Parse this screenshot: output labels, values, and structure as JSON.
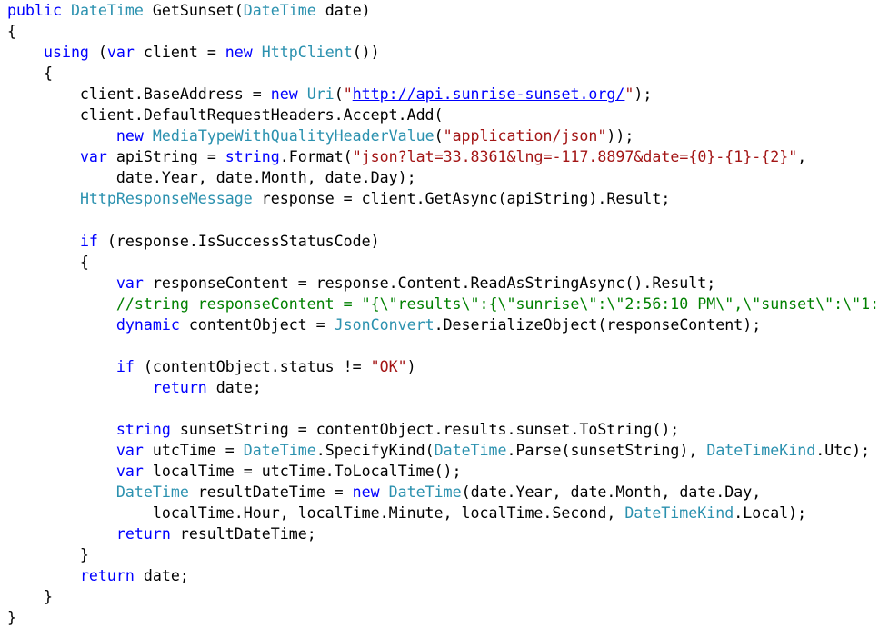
{
  "editor": {
    "language": "C#",
    "colors": {
      "keyword": "#0000ff",
      "type": "#2b91af",
      "string": "#a31515",
      "comment": "#008000",
      "text": "#000000",
      "background": "#ffffff"
    },
    "lines": [
      [
        [
          "kw",
          "public"
        ],
        [
          "t",
          " "
        ],
        [
          "ty",
          "DateTime"
        ],
        [
          "t",
          " GetSunset("
        ],
        [
          "ty",
          "DateTime"
        ],
        [
          "t",
          " date)"
        ]
      ],
      [
        [
          "t",
          "{"
        ]
      ],
      [
        [
          "t",
          "    "
        ],
        [
          "kw",
          "using"
        ],
        [
          "t",
          " ("
        ],
        [
          "kw",
          "var"
        ],
        [
          "t",
          " client = "
        ],
        [
          "kw",
          "new"
        ],
        [
          "t",
          " "
        ],
        [
          "ty",
          "HttpClient"
        ],
        [
          "t",
          "())"
        ]
      ],
      [
        [
          "t",
          "    {"
        ]
      ],
      [
        [
          "t",
          "        client.BaseAddress = "
        ],
        [
          "kw",
          "new"
        ],
        [
          "t",
          " "
        ],
        [
          "ty",
          "Uri"
        ],
        [
          "t",
          "("
        ],
        [
          "st",
          "\""
        ],
        [
          "url",
          "http://api.sunrise-sunset.org/"
        ],
        [
          "st",
          "\""
        ],
        [
          "t",
          ");"
        ]
      ],
      [
        [
          "t",
          "        client.DefaultRequestHeaders.Accept.Add("
        ]
      ],
      [
        [
          "t",
          "            "
        ],
        [
          "kw",
          "new"
        ],
        [
          "t",
          " "
        ],
        [
          "ty",
          "MediaTypeWithQualityHeaderValue"
        ],
        [
          "t",
          "("
        ],
        [
          "st",
          "\"application/json\""
        ],
        [
          "t",
          "));"
        ]
      ],
      [
        [
          "t",
          "        "
        ],
        [
          "kw",
          "var"
        ],
        [
          "t",
          " apiString = "
        ],
        [
          "kw",
          "string"
        ],
        [
          "t",
          ".Format("
        ],
        [
          "st",
          "\"json?lat=33.8361&lng=-117.8897&date={0}-{1}-{2}\""
        ],
        [
          "t",
          ","
        ]
      ],
      [
        [
          "t",
          "            date.Year, date.Month, date.Day);"
        ]
      ],
      [
        [
          "t",
          "        "
        ],
        [
          "ty",
          "HttpResponseMessage"
        ],
        [
          "t",
          " response = client.GetAsync(apiString).Result;"
        ]
      ],
      [
        [
          "t",
          ""
        ]
      ],
      [
        [
          "t",
          "        "
        ],
        [
          "kw",
          "if"
        ],
        [
          "t",
          " (response.IsSuccessStatusCode)"
        ]
      ],
      [
        [
          "t",
          "        {"
        ]
      ],
      [
        [
          "t",
          "            "
        ],
        [
          "kw",
          "var"
        ],
        [
          "t",
          " responseContent = response.Content.ReadAsStringAsync().Result;"
        ]
      ],
      [
        [
          "t",
          "            "
        ],
        [
          "cm",
          "//string responseContent = \"{\\\"results\\\":{\\\"sunrise\\\":\\\"2:56:10 PM\\\",\\\"sunset\\\":\\\"1:"
        ]
      ],
      [
        [
          "t",
          "            "
        ],
        [
          "kw",
          "dynamic"
        ],
        [
          "t",
          " contentObject = "
        ],
        [
          "ty",
          "JsonConvert"
        ],
        [
          "t",
          ".DeserializeObject(responseContent);"
        ]
      ],
      [
        [
          "t",
          ""
        ]
      ],
      [
        [
          "t",
          "            "
        ],
        [
          "kw",
          "if"
        ],
        [
          "t",
          " (contentObject.status != "
        ],
        [
          "st",
          "\"OK\""
        ],
        [
          "t",
          ")"
        ]
      ],
      [
        [
          "t",
          "                "
        ],
        [
          "kw",
          "return"
        ],
        [
          "t",
          " date;"
        ]
      ],
      [
        [
          "t",
          ""
        ]
      ],
      [
        [
          "t",
          "            "
        ],
        [
          "kw",
          "string"
        ],
        [
          "t",
          " sunsetString = contentObject.results.sunset.ToString();"
        ]
      ],
      [
        [
          "t",
          "            "
        ],
        [
          "kw",
          "var"
        ],
        [
          "t",
          " utcTime = "
        ],
        [
          "ty",
          "DateTime"
        ],
        [
          "t",
          ".SpecifyKind("
        ],
        [
          "ty",
          "DateTime"
        ],
        [
          "t",
          ".Parse(sunsetString), "
        ],
        [
          "ty",
          "DateTimeKind"
        ],
        [
          "t",
          ".Utc);"
        ]
      ],
      [
        [
          "t",
          "            "
        ],
        [
          "kw",
          "var"
        ],
        [
          "t",
          " localTime = utcTime.ToLocalTime();"
        ]
      ],
      [
        [
          "t",
          "            "
        ],
        [
          "ty",
          "DateTime"
        ],
        [
          "t",
          " resultDateTime = "
        ],
        [
          "kw",
          "new"
        ],
        [
          "t",
          " "
        ],
        [
          "ty",
          "DateTime"
        ],
        [
          "t",
          "(date.Year, date.Month, date.Day,"
        ]
      ],
      [
        [
          "t",
          "                localTime.Hour, localTime.Minute, localTime.Second, "
        ],
        [
          "ty",
          "DateTimeKind"
        ],
        [
          "t",
          ".Local);"
        ]
      ],
      [
        [
          "t",
          "            "
        ],
        [
          "kw",
          "return"
        ],
        [
          "t",
          " resultDateTime;"
        ]
      ],
      [
        [
          "t",
          "        }"
        ]
      ],
      [
        [
          "t",
          "        "
        ],
        [
          "kw",
          "return"
        ],
        [
          "t",
          " date;"
        ]
      ],
      [
        [
          "t",
          "    }"
        ]
      ],
      [
        [
          "t",
          "}"
        ]
      ]
    ]
  }
}
